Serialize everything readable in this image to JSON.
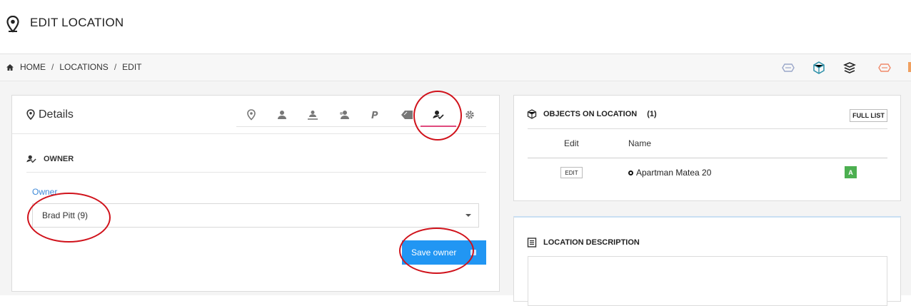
{
  "page": {
    "title": "EDIT LOCATION"
  },
  "breadcrumb": [
    "HOME",
    "LOCATIONS",
    "EDIT"
  ],
  "breadcrumb_sep": "/",
  "quick_icons": [
    "layer-pink-icon",
    "cube-blue-icon",
    "layers-icon",
    "layer-orange-icon"
  ],
  "details": {
    "title": "Details",
    "tabs": [
      "location-icon",
      "person-icon",
      "people-icon",
      "user-group-icon",
      "paypal-icon",
      "tag-icon",
      "owner-icon",
      "gear-icon"
    ],
    "active_tab": "owner-icon",
    "section_title": "OWNER",
    "owner_label": "Owner",
    "owner_value": "Brad Pitt (9)",
    "save_label": "Save owner"
  },
  "objects": {
    "title": "OBJECTS ON LOCATION",
    "count": "(1)",
    "full_list_label": "FULL LIST",
    "columns": [
      "Edit",
      "Name"
    ],
    "rows": [
      {
        "edit": "EDIT",
        "name": "Apartman Matea 20",
        "badge": "A"
      }
    ]
  },
  "description": {
    "title": "LOCATION DESCRIPTION"
  },
  "colors": {
    "primary": "#2196f3",
    "accent": "#e0497d",
    "annotation": "#d0121b",
    "badge": "#4caf50",
    "link": "#3f8ad9"
  }
}
